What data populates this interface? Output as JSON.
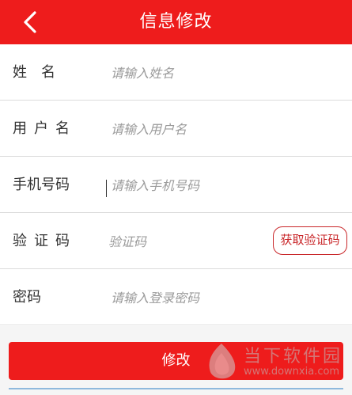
{
  "header": {
    "back_icon": "chevron-left-icon",
    "title": "信息修改",
    "background": "#ee1c1c"
  },
  "form": {
    "name": {
      "label": "姓　名",
      "placeholder": "请输入姓名",
      "value": ""
    },
    "username": {
      "label": "用户名",
      "placeholder": "请输入用户名",
      "value": ""
    },
    "phone": {
      "label": "手机号码",
      "placeholder": "请输入手机号码",
      "value": ""
    },
    "code": {
      "label": "验证码",
      "placeholder": "验证码",
      "value": "",
      "button_label": "获取验证码"
    },
    "password": {
      "label": "密码",
      "placeholder": "请输入登录密码",
      "value": ""
    }
  },
  "submit": {
    "label": "修改"
  },
  "watermark": {
    "text": "当下软件园",
    "url": "www.downxia.com"
  }
}
